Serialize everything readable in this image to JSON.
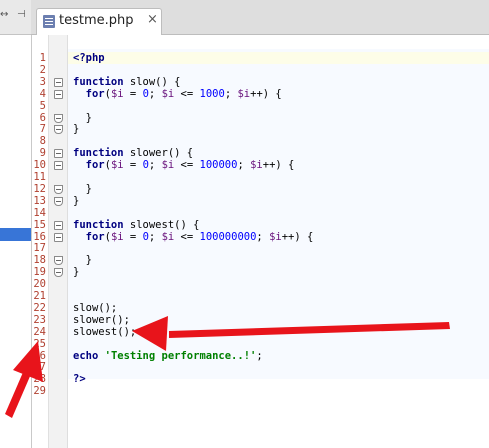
{
  "left_toolbar": {
    "left_icon": "arrows-expand-icon",
    "right_icon": "collapse-icon",
    "arrow_glyph": "↔",
    "pin_glyph": "⊣"
  },
  "tab": {
    "label": "testme.php",
    "close": "×",
    "icon": "php-file-icon"
  },
  "lines": [
    {
      "n": "1",
      "code": [
        {
          "t": "<?php",
          "c": "kw"
        }
      ]
    },
    {
      "n": "2",
      "code": []
    },
    {
      "n": "3",
      "code": [
        {
          "t": "function",
          "c": "kw"
        },
        {
          "t": " slow() {",
          "c": ""
        }
      ]
    },
    {
      "n": "4",
      "code": [
        {
          "t": "  ",
          "c": ""
        },
        {
          "t": "for",
          "c": "kw"
        },
        {
          "t": "(",
          "c": ""
        },
        {
          "t": "$i",
          "c": "var"
        },
        {
          "t": " = ",
          "c": ""
        },
        {
          "t": "0",
          "c": "num"
        },
        {
          "t": "; ",
          "c": ""
        },
        {
          "t": "$i",
          "c": "var"
        },
        {
          "t": " <= ",
          "c": ""
        },
        {
          "t": "1000",
          "c": "num"
        },
        {
          "t": "; ",
          "c": ""
        },
        {
          "t": "$i",
          "c": "var"
        },
        {
          "t": "++) {",
          "c": ""
        }
      ]
    },
    {
      "n": "5",
      "code": []
    },
    {
      "n": "6",
      "code": [
        {
          "t": "  }",
          "c": ""
        }
      ]
    },
    {
      "n": "7",
      "code": [
        {
          "t": "}",
          "c": ""
        }
      ]
    },
    {
      "n": "8",
      "code": []
    },
    {
      "n": "9",
      "code": [
        {
          "t": "function",
          "c": "kw"
        },
        {
          "t": " slower() {",
          "c": ""
        }
      ]
    },
    {
      "n": "10",
      "code": [
        {
          "t": "  ",
          "c": ""
        },
        {
          "t": "for",
          "c": "kw"
        },
        {
          "t": "(",
          "c": ""
        },
        {
          "t": "$i",
          "c": "var"
        },
        {
          "t": " = ",
          "c": ""
        },
        {
          "t": "0",
          "c": "num"
        },
        {
          "t": "; ",
          "c": ""
        },
        {
          "t": "$i",
          "c": "var"
        },
        {
          "t": " <= ",
          "c": ""
        },
        {
          "t": "100000",
          "c": "num"
        },
        {
          "t": "; ",
          "c": ""
        },
        {
          "t": "$i",
          "c": "var"
        },
        {
          "t": "++) {",
          "c": ""
        }
      ]
    },
    {
      "n": "11",
      "code": []
    },
    {
      "n": "12",
      "code": [
        {
          "t": "  }",
          "c": ""
        }
      ]
    },
    {
      "n": "13",
      "code": [
        {
          "t": "}",
          "c": ""
        }
      ]
    },
    {
      "n": "14",
      "code": []
    },
    {
      "n": "15",
      "code": [
        {
          "t": "function",
          "c": "kw"
        },
        {
          "t": " slowest() {",
          "c": ""
        }
      ]
    },
    {
      "n": "16",
      "code": [
        {
          "t": "  ",
          "c": ""
        },
        {
          "t": "for",
          "c": "kw"
        },
        {
          "t": "(",
          "c": ""
        },
        {
          "t": "$i",
          "c": "var"
        },
        {
          "t": " = ",
          "c": ""
        },
        {
          "t": "0",
          "c": "num"
        },
        {
          "t": "; ",
          "c": ""
        },
        {
          "t": "$i",
          "c": "var"
        },
        {
          "t": " <= ",
          "c": ""
        },
        {
          "t": "100000000",
          "c": "num"
        },
        {
          "t": "; ",
          "c": ""
        },
        {
          "t": "$i",
          "c": "var"
        },
        {
          "t": "++) {",
          "c": ""
        }
      ]
    },
    {
      "n": "17",
      "code": []
    },
    {
      "n": "18",
      "code": [
        {
          "t": "  }",
          "c": ""
        }
      ]
    },
    {
      "n": "19",
      "code": [
        {
          "t": "}",
          "c": ""
        }
      ]
    },
    {
      "n": "20",
      "code": []
    },
    {
      "n": "21",
      "code": []
    },
    {
      "n": "22",
      "code": [
        {
          "t": "slow();",
          "c": ""
        }
      ]
    },
    {
      "n": "23",
      "code": [
        {
          "t": "slower();",
          "c": ""
        }
      ]
    },
    {
      "n": "24",
      "code": [
        {
          "t": "slowest();",
          "c": ""
        }
      ]
    },
    {
      "n": "25",
      "code": []
    },
    {
      "n": "26",
      "code": [
        {
          "t": "echo",
          "c": "kw"
        },
        {
          "t": " ",
          "c": ""
        },
        {
          "t": "'Testing performance..!'",
          "c": "str"
        },
        {
          "t": ";",
          "c": ""
        }
      ]
    },
    {
      "n": "27",
      "code": []
    },
    {
      "n": "28",
      "code": [
        {
          "t": "?>",
          "c": "kw"
        }
      ]
    },
    {
      "n": "29",
      "code": []
    }
  ],
  "fold_lines": [
    "3",
    "4",
    "6",
    "7",
    "9",
    "10",
    "12",
    "13",
    "15",
    "16",
    "18",
    "19"
  ],
  "annotation": {
    "arrow_color": "#e8141b"
  }
}
